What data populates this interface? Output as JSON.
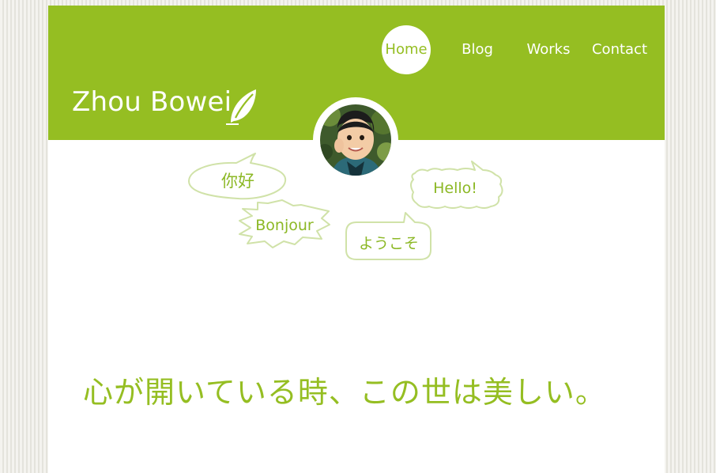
{
  "site": {
    "name": "Zhou Bowei"
  },
  "nav": {
    "items": [
      "Home",
      "Blog",
      "Works",
      "Contact"
    ],
    "active": "Home"
  },
  "greetings": {
    "chinese": "你好",
    "french": "Bonjour",
    "japanese": "ようこそ",
    "english": "Hello!"
  },
  "slogan": "心が開いている時、この世は美しい。",
  "colors": {
    "brand_green": "#95be22",
    "bubble_stroke": "#d0e2a8",
    "bubble_text": "#8cb825"
  },
  "icons": {
    "logo_mark": "leaf-icon"
  }
}
